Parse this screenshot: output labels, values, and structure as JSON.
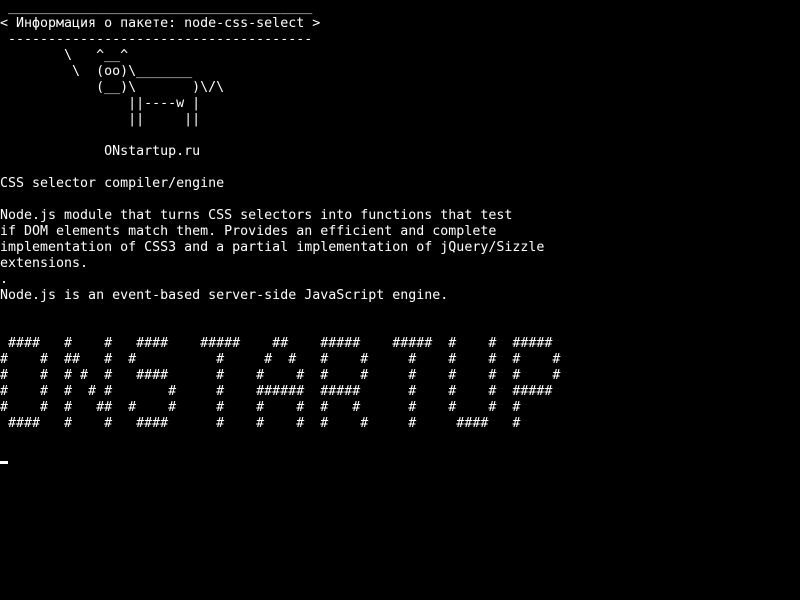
{
  "terminal": {
    "cowsay_bubble": [
      " ______________________________________",
      "< Информация о пакете: node-css-select >",
      " --------------------------------------"
    ],
    "cow": [
      "        \\   ^__^",
      "         \\  (oo)\\_______",
      "            (__)\\       )\\/\\",
      "                ||----w |",
      "                ||     ||"
    ],
    "site": "             ONstartup.ru",
    "package_summary": "CSS selector compiler/engine",
    "description": [
      "Node.js module that turns CSS selectors into functions that test",
      "if DOM elements match them. Provides an efficient and complete",
      "implementation of CSS3 and a partial implementation of jQuery/Sizzle",
      "extensions.",
      ".",
      "Node.js is an event-based server-side JavaScript engine."
    ],
    "banner": [
      " ####   #    #   ####    #####    ##    #####    #####  #    #  #####",
      "#    #  ##   #  #          #     #  #   #    #     #    #    #  #    #",
      "#    #  # #  #   ####      #    #    #  #    #     #    #    #  #    #",
      "#    #  #  # #       #     #    ######  #####      #    #    #  #####",
      "#    #  #   ##  #    #     #    #    #  #   #      #    #    #  #",
      " ####   #    #   ####      #    #    #  #    #     #     ####   #"
    ],
    "colors": {
      "background": "#000000",
      "foreground": "#ffffff"
    }
  }
}
